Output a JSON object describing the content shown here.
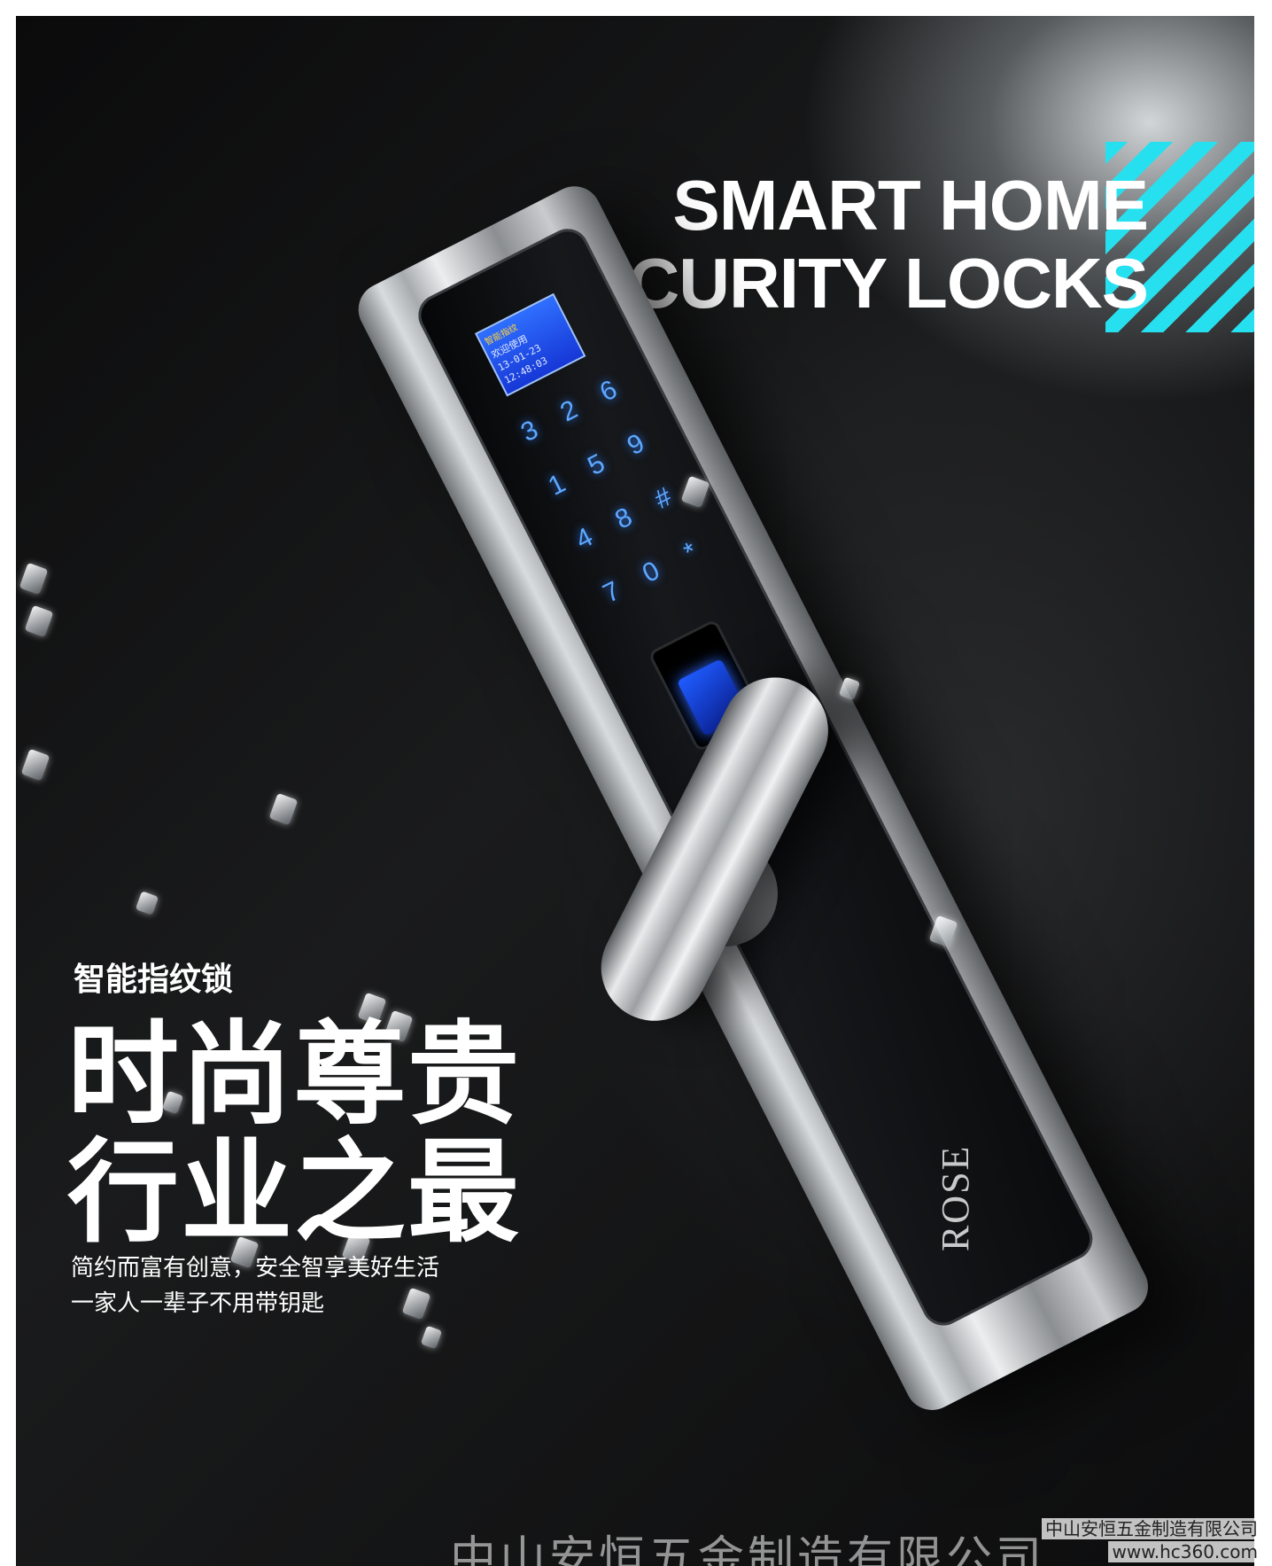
{
  "headline": {
    "line1": "SMART HOME",
    "line2": "SECURITY LOCKS"
  },
  "accent_color": "#27e0ef",
  "product": {
    "lcd_top": "智能指纹",
    "lcd_line1": "欢迎使用",
    "lcd_line2": "13-01-23",
    "lcd_line3": "12:48:03",
    "keys": [
      "3",
      "2",
      "6",
      "1",
      "5",
      "9",
      "4",
      "8",
      "#",
      "7",
      "0",
      "*"
    ],
    "brand": "ROSE"
  },
  "copy": {
    "subtitle": "智能指纹锁",
    "title_line1": "时尚尊贵",
    "title_line2": "行业之最",
    "body_line1": "简约而富有创意，安全智享美好生活",
    "body_line2": "一家人一辈子不用带钥匙"
  },
  "watermark": {
    "company": "中山安恒五金制造有限公司",
    "small_company": "中山安恒五金制造有限公司",
    "site": "www.hc360.com"
  }
}
